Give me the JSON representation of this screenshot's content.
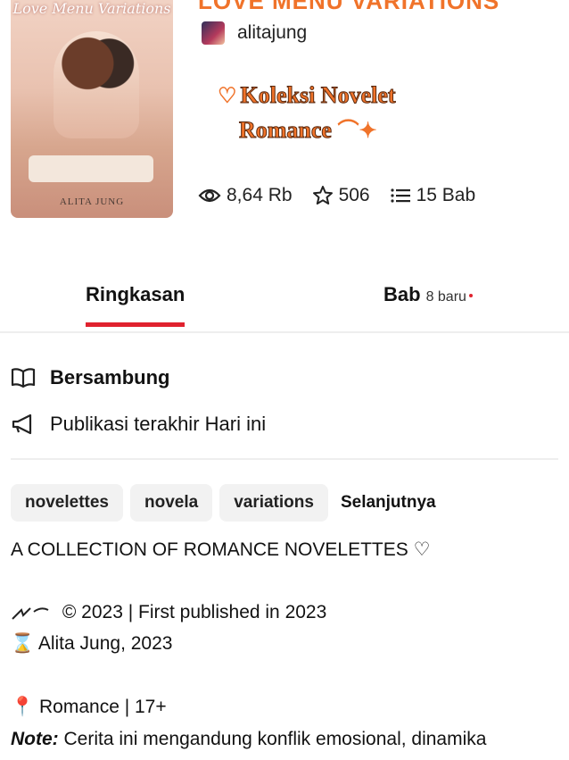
{
  "book": {
    "title": "LOVE MENU VARIATIONS",
    "cover_title": "Love Menu Variations",
    "cover_author": "ALITA JUNG",
    "author": "alitajung",
    "promo_line1": "Koleksi Novelet",
    "promo_line2": "Romance",
    "promo_heart": "♡",
    "promo_sparkle": "⌒✦"
  },
  "stats": {
    "reads": "8,64 Rb",
    "votes": "506",
    "chapters": "15 Bab"
  },
  "tabs": {
    "summary": "Ringkasan",
    "chapters": "Bab",
    "chapters_new": "8 baru"
  },
  "status": {
    "state": "Bersambung",
    "last_published": "Publikasi terakhir Hari ini"
  },
  "tags": [
    "novelettes",
    "novela",
    "variations"
  ],
  "tags_more": "Selanjutnya",
  "description": {
    "line1": "A COLLECTION OF ROMANCE NOVELETTES ♡",
    "line2": "© 2023 | First published in 2023",
    "line3": "Alita Jung, 2023",
    "line4": "Romance | 17+",
    "note_label": "Note:",
    "note_text": "Cerita ini mengandung konflik emosional, dinamika"
  },
  "colors": {
    "accent": "#f0732a",
    "tab_underline": "#e0222e",
    "tag_bg": "#f2f2f2"
  }
}
